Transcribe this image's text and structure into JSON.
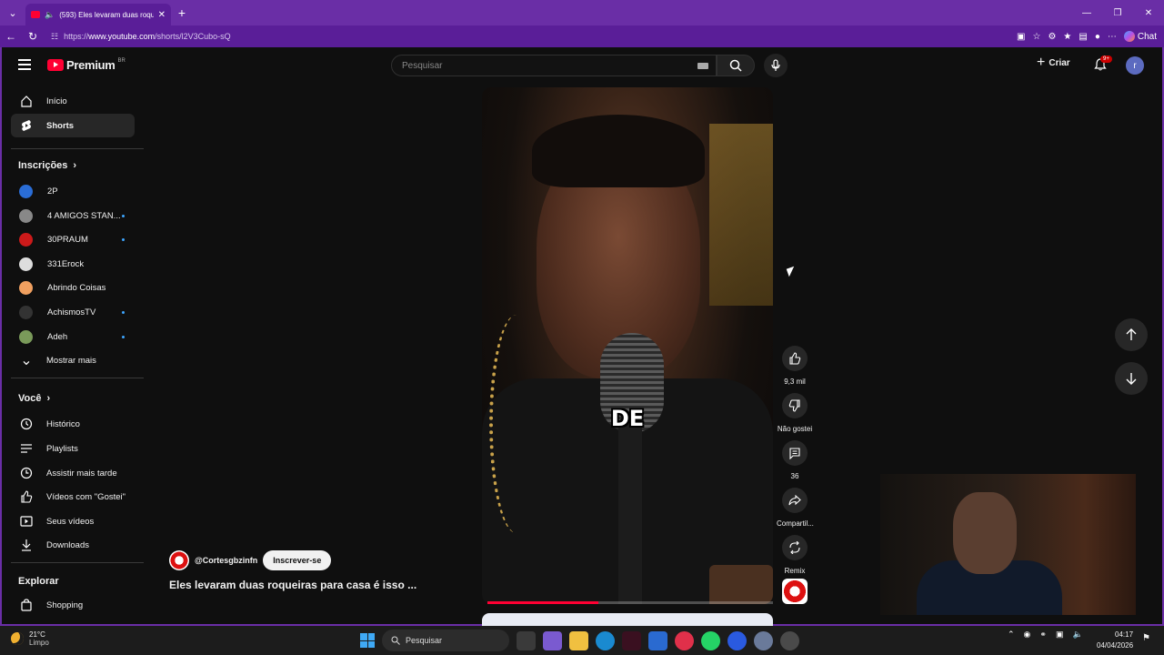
{
  "browser": {
    "tab_title": "(593) Eles levaram duas roqu",
    "url_prefix": "https://",
    "url_domain": "www.youtube.com",
    "url_path": "/shorts/l2V3Cubo-sQ",
    "chat_label": "Chat"
  },
  "header": {
    "logo_text": "Premium",
    "logo_region": "BR",
    "search_placeholder": "Pesquisar",
    "create_label": "Criar",
    "notif_count": "9+",
    "avatar_letter": "r"
  },
  "sidebar": {
    "main": [
      {
        "label": "Início",
        "icon": "home-icon"
      },
      {
        "label": "Shorts",
        "icon": "shorts-icon",
        "active": true
      }
    ],
    "subs_heading": "Inscrições",
    "subscriptions": [
      {
        "label": "2P",
        "color": "#2a6dd6",
        "new": false
      },
      {
        "label": "4 AMIGOS STAN...",
        "color": "#888888",
        "new": true
      },
      {
        "label": "30PRAUM",
        "color": "#cc1a1a",
        "new": true
      },
      {
        "label": "331Erock",
        "color": "#dddddd",
        "new": false
      },
      {
        "label": "Abrindo Coisas",
        "color": "#f0a060",
        "new": false
      },
      {
        "label": "AchismosTV",
        "color": "#333333",
        "new": true
      },
      {
        "label": "Adeh",
        "color": "#7a9a5a",
        "new": true
      }
    ],
    "show_more": "Mostrar mais",
    "you_heading": "Você",
    "you_items": [
      {
        "label": "Histórico",
        "icon": "history-icon"
      },
      {
        "label": "Playlists",
        "icon": "playlists-icon"
      },
      {
        "label": "Assistir mais tarde",
        "icon": "watch-later-icon"
      },
      {
        "label": "Vídeos com \"Gostei\"",
        "icon": "liked-icon"
      },
      {
        "label": "Seus vídeos",
        "icon": "your-videos-icon"
      },
      {
        "label": "Downloads",
        "icon": "downloads-icon"
      }
    ],
    "explore_heading": "Explorar",
    "explore_items": [
      {
        "label": "Shopping",
        "icon": "shopping-icon"
      }
    ]
  },
  "short": {
    "caption": "DE",
    "channel": "@Cortesgbzinfn",
    "subscribe_label": "Inscrever-se",
    "title": "Eles levaram duas roqueiras para casa é isso ...",
    "progress": 0.39,
    "actions": {
      "like_count": "9,3 mil",
      "dislike_label": "Não gostei",
      "comments_count": "36",
      "share_label": "Compartil...",
      "remix_label": "Remix"
    }
  },
  "taskbar": {
    "temp": "21°C",
    "weather": "Limpo",
    "search_placeholder": "Pesquisar",
    "time": "04:17",
    "date": "04/04/2026"
  }
}
